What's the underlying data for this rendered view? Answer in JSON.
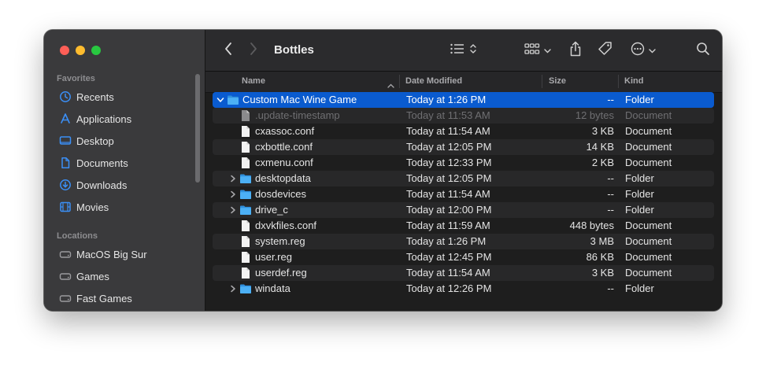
{
  "window": {
    "title": "Bottles"
  },
  "sidebar": {
    "favorites_header": "Favorites",
    "favorites": [
      {
        "label": "Recents",
        "icon": "clock-icon"
      },
      {
        "label": "Applications",
        "icon": "applications-icon"
      },
      {
        "label": "Desktop",
        "icon": "desktop-icon"
      },
      {
        "label": "Documents",
        "icon": "document-icon"
      },
      {
        "label": "Downloads",
        "icon": "downloads-icon"
      },
      {
        "label": "Movies",
        "icon": "film-icon"
      }
    ],
    "locations_header": "Locations",
    "locations": [
      {
        "label": "MacOS Big Sur",
        "icon": "disk-icon"
      },
      {
        "label": "Games",
        "icon": "disk-icon"
      },
      {
        "label": "Fast Games",
        "icon": "disk-icon"
      }
    ]
  },
  "columns": {
    "name": "Name",
    "date": "Date Modified",
    "size": "Size",
    "kind": "Kind"
  },
  "rows": [
    {
      "name": "Custom Mac Wine Game",
      "date": "Today at 1:26 PM",
      "size": "--",
      "kind": "Folder",
      "type": "folder",
      "expanded": true,
      "selected": true,
      "indent": 0
    },
    {
      "name": ".update-timestamp",
      "date": "Today at 11:53 AM",
      "size": "12 bytes",
      "kind": "Document",
      "type": "file",
      "hidden": true,
      "indent": 1
    },
    {
      "name": "cxassoc.conf",
      "date": "Today at 11:54 AM",
      "size": "3 KB",
      "kind": "Document",
      "type": "file",
      "indent": 1
    },
    {
      "name": "cxbottle.conf",
      "date": "Today at 12:05 PM",
      "size": "14 KB",
      "kind": "Document",
      "type": "file",
      "indent": 1
    },
    {
      "name": "cxmenu.conf",
      "date": "Today at 12:33 PM",
      "size": "2 KB",
      "kind": "Document",
      "type": "file",
      "indent": 1
    },
    {
      "name": "desktopdata",
      "date": "Today at 12:05 PM",
      "size": "--",
      "kind": "Folder",
      "type": "folder",
      "indent": 1
    },
    {
      "name": "dosdevices",
      "date": "Today at 11:54 AM",
      "size": "--",
      "kind": "Folder",
      "type": "folder",
      "indent": 1
    },
    {
      "name": "drive_c",
      "date": "Today at 12:00 PM",
      "size": "--",
      "kind": "Folder",
      "type": "folder",
      "indent": 1
    },
    {
      "name": "dxvkfiles.conf",
      "date": "Today at 11:59 AM",
      "size": "448 bytes",
      "kind": "Document",
      "type": "file",
      "indent": 1
    },
    {
      "name": "system.reg",
      "date": "Today at 1:26 PM",
      "size": "3 MB",
      "kind": "Document",
      "type": "file",
      "indent": 1
    },
    {
      "name": "user.reg",
      "date": "Today at 12:45 PM",
      "size": "86 KB",
      "kind": "Document",
      "type": "file",
      "indent": 1
    },
    {
      "name": "userdef.reg",
      "date": "Today at 11:54 AM",
      "size": "3 KB",
      "kind": "Document",
      "type": "file",
      "indent": 1
    },
    {
      "name": "windata",
      "date": "Today at 12:26 PM",
      "size": "--",
      "kind": "Folder",
      "type": "folder",
      "indent": 1
    }
  ],
  "colors": {
    "selection": "#0a5bcf",
    "folder": "#3aa3f0",
    "accent": "#3b8ff6"
  }
}
